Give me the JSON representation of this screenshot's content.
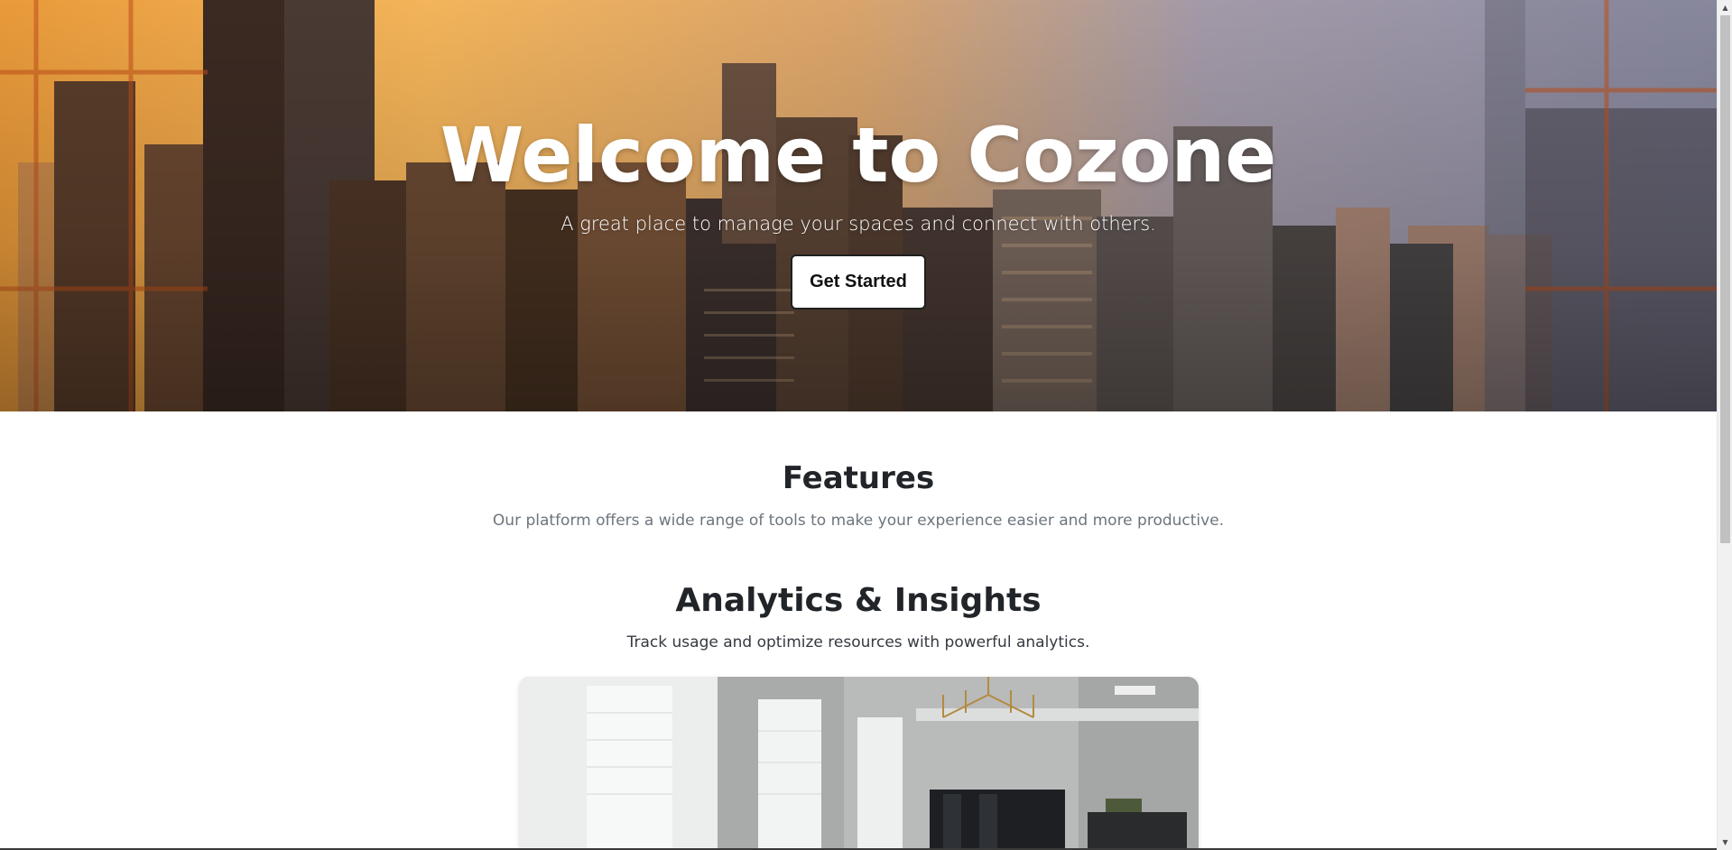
{
  "hero": {
    "title": "Welcome to Cozone",
    "subtitle": "A great place to manage your spaces and connect with others.",
    "cta_label": "Get Started"
  },
  "features": {
    "title": "Features",
    "description": "Our platform offers a wide range of tools to make your experience easier and more productive."
  },
  "analytics": {
    "title": "Analytics & Insights",
    "description": "Track usage and optimize resources with powerful analytics."
  },
  "scrollbar": {
    "up_icon": "scroll-up-arrow-icon",
    "down_icon": "scroll-down-arrow-icon"
  },
  "colors": {
    "text_dark": "#212529",
    "text_muted": "#6c757d",
    "button_bg": "#ffffff"
  }
}
